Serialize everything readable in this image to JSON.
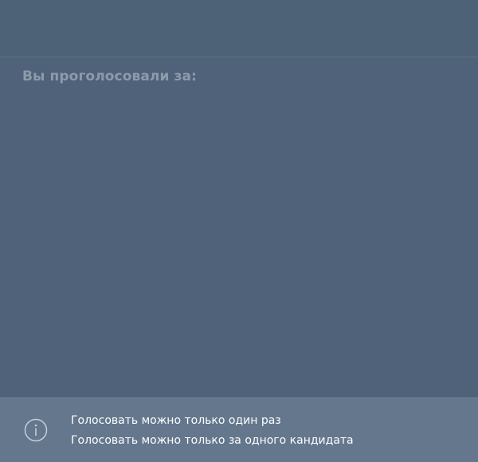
{
  "header": {
    "voted_for_label": "Вы проголосовали за:"
  },
  "info": {
    "icon": "info-icon",
    "lines": [
      "Голосовать можно только один раз",
      "Голосовать можно только за одного кандидата"
    ]
  },
  "colors": {
    "background": "#4f6279",
    "heading_text": "#8d9bab",
    "info_panel": "#64778d",
    "info_text": "#ffffff"
  }
}
